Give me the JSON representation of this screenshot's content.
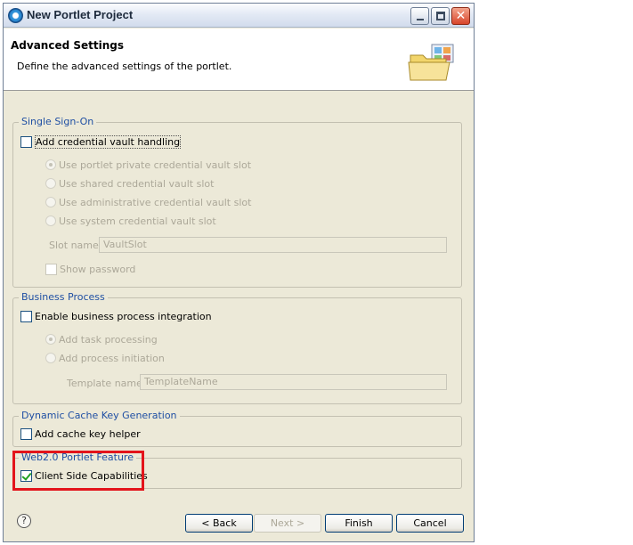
{
  "window": {
    "title": "New Portlet Project"
  },
  "header": {
    "title": "Advanced Settings",
    "description": "Define the advanced settings of the portlet."
  },
  "single_sign_on": {
    "group_title": "Single Sign-On",
    "vault_checkbox": {
      "label": "Add credential vault handling",
      "checked": false
    },
    "radios": [
      {
        "label": "Use portlet private credential vault slot",
        "selected": true
      },
      {
        "label": "Use shared credential vault slot",
        "selected": false
      },
      {
        "label": "Use administrative credential vault slot",
        "selected": false
      },
      {
        "label": "Use system credential vault slot",
        "selected": false
      }
    ],
    "slot_name_label": "Slot name:",
    "slot_name_value": "VaultSlot",
    "show_password": {
      "label": "Show password",
      "checked": false
    }
  },
  "business_process": {
    "group_title": "Business Process",
    "enable_checkbox": {
      "label": "Enable business process integration",
      "checked": false
    },
    "radios": [
      {
        "label": "Add task processing",
        "selected": true
      },
      {
        "label": "Add process initiation",
        "selected": false
      }
    ],
    "template_name_label": "Template name:",
    "template_name_value": "TemplateName"
  },
  "dynamic_cache": {
    "group_title": "Dynamic Cache Key Generation",
    "cache_checkbox": {
      "label": "Add cache key helper",
      "checked": false
    }
  },
  "web20": {
    "group_title": "Web2.0 Portlet Feature",
    "client_side": {
      "label": "Client Side Capabilities",
      "checked": true
    }
  },
  "footer": {
    "help_glyph": "?",
    "back_label": "< Back",
    "next_label": "Next >",
    "finish_label": "Finish",
    "cancel_label": "Cancel"
  },
  "colors": {
    "group_title": "#1f4fa3",
    "highlight": "#e3141b",
    "dialog_bg": "#ece9d8"
  },
  "icons": [
    "app-icon",
    "folder-banner-icon",
    "help-icon",
    "minimize-icon",
    "maximize-icon",
    "close-icon"
  ]
}
